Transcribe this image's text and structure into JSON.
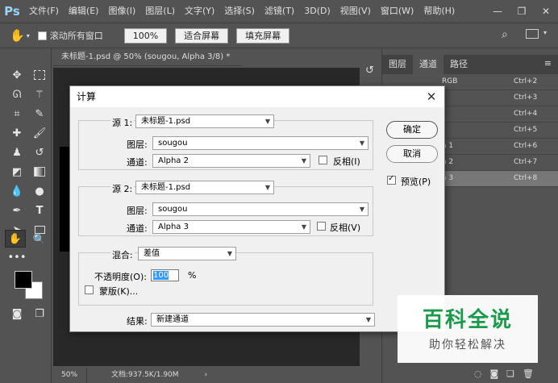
{
  "app": {
    "logo": "Ps",
    "menu": [
      "文件(F)",
      "编辑(E)",
      "图像(I)",
      "图层(L)",
      "文字(Y)",
      "选择(S)",
      "滤镜(T)",
      "3D(D)",
      "视图(V)",
      "窗口(W)",
      "帮助(H)"
    ],
    "window_controls": [
      "—",
      "❐",
      "✕"
    ]
  },
  "options_bar": {
    "scroll_all_windows": "滚动所有窗口",
    "zoom_value": "100%",
    "fit_screen": "适合屏幕",
    "fill_screen": "填充屏幕"
  },
  "document": {
    "tab_title": "未标题-1.psd @ 50% (sougou, Alpha 3/8) *",
    "zoom": "50%",
    "doc_info": "文档:937.5K/1.90M"
  },
  "panel": {
    "tabs": [
      "图层",
      "通道",
      "路径"
    ],
    "active_tab": "通道",
    "channels": [
      {
        "name": "RGB",
        "shortcut": "Ctrl+2",
        "selected": false
      },
      {
        "name": "",
        "shortcut": "Ctrl+3",
        "selected": false
      },
      {
        "name": "",
        "shortcut": "Ctrl+4",
        "selected": false
      },
      {
        "name": "",
        "shortcut": "Ctrl+5",
        "selected": false
      },
      {
        "name": "a 1",
        "shortcut": "Ctrl+6",
        "selected": false
      },
      {
        "name": "a 2",
        "shortcut": "Ctrl+7",
        "selected": false
      },
      {
        "name": "a 3",
        "shortcut": "Ctrl+8",
        "selected": true
      }
    ]
  },
  "dialog": {
    "title": "计算",
    "source1": {
      "label": "源 1:",
      "file": "未标题-1.psd",
      "layer_label": "图层:",
      "layer": "sougou",
      "channel_label": "通道:",
      "channel": "Alpha 2",
      "invert_label": "反相(I)"
    },
    "source2": {
      "label": "源 2:",
      "file": "未标题-1.psd",
      "layer_label": "图层:",
      "layer": "sougou",
      "channel_label": "通道:",
      "channel": "Alpha 3",
      "invert_label": "反相(V)"
    },
    "blend": {
      "label": "混合:",
      "mode": "差值",
      "opacity_label": "不透明度(O):",
      "opacity": "100",
      "opacity_unit": "%",
      "mask_label": "蒙版(K)..."
    },
    "result": {
      "label": "结果:",
      "value": "新建通道"
    },
    "ok": "确定",
    "cancel": "取消",
    "preview": "预览(P)",
    "preview_checked": true
  },
  "watermark": {
    "title": "百科全说",
    "subtitle": "助你轻松解决"
  }
}
